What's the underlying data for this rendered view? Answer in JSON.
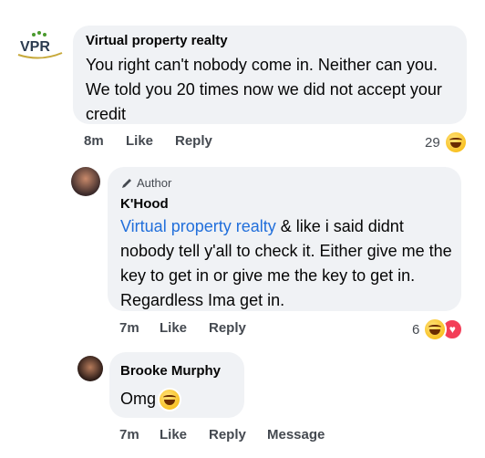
{
  "comments": [
    {
      "author": "Virtual property realty",
      "avatar_text": "VPR",
      "text": "You right can't nobody come in. Neither can you. We told you 20 times now we did not accept your credit",
      "time": "8m",
      "like": "Like",
      "reply": "Reply",
      "reaction_count": "29"
    },
    {
      "badge": "Author",
      "author": "K'Hood",
      "mention": "Virtual property realty",
      "text": " & like i said didnt nobody tell y'all to check it. Either give me the key to get in or give me the key to get in. Regardless Ima get in.",
      "time": "7m",
      "like": "Like",
      "reply": "Reply",
      "reaction_count": "6"
    },
    {
      "author": "Brooke Murphy",
      "text": "Omg",
      "time": "7m",
      "like": "Like",
      "reply": "Reply",
      "message": "Message"
    }
  ],
  "colors": {
    "bubble": "#f0f2f5",
    "mention": "#216fdb",
    "meta": "#444950",
    "vpr_green": "#4a9a2e"
  },
  "icons": [
    "pencil-icon",
    "laugh-reaction-icon",
    "love-reaction-icon"
  ]
}
